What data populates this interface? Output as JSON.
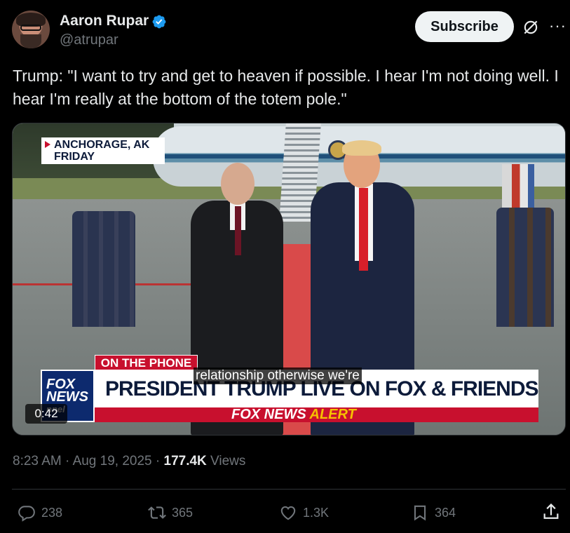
{
  "author": {
    "name": "Aaron Rupar",
    "handle": "@atrupar",
    "avatar_icon": "avatar-image",
    "verified_icon": "verified-badge-icon",
    "verified_color": "#1d9bf0"
  },
  "header": {
    "subscribe_label": "Subscribe",
    "grok_icon": "grok-icon",
    "more_label": "···"
  },
  "tweet": {
    "text": "Trump: \"I want to try and get to heaven if possible. I hear I'm not doing well. I hear I'm really at the bottom of the totem pole.\""
  },
  "video": {
    "location_line1": "ANCHORAGE, AK",
    "location_line2": "FRIDAY",
    "phone_tag": "ON THE PHONE",
    "channel_logo_line1": "FOX",
    "channel_logo_line2": "NEWS",
    "channel_logo_line3": "nnel",
    "headline": "PRESIDENT TRUMP LIVE ON FOX & FRIENDS",
    "alert_prefix": "FOX NEWS",
    "alert_word": "ALERT",
    "subtitle": "relationship otherwise we're",
    "time_remaining": "0:42",
    "alert_color": "#c8102e",
    "alert_highlight_color": "#f6c100"
  },
  "meta": {
    "time": "8:23 AM",
    "separator": " · ",
    "date": "Aug 19, 2025",
    "separator2": " · ",
    "views_count": "177.4K",
    "views_label": " Views"
  },
  "actions": {
    "replies": "238",
    "retweets": "365",
    "likes": "1.3K",
    "bookmarks": "364"
  }
}
